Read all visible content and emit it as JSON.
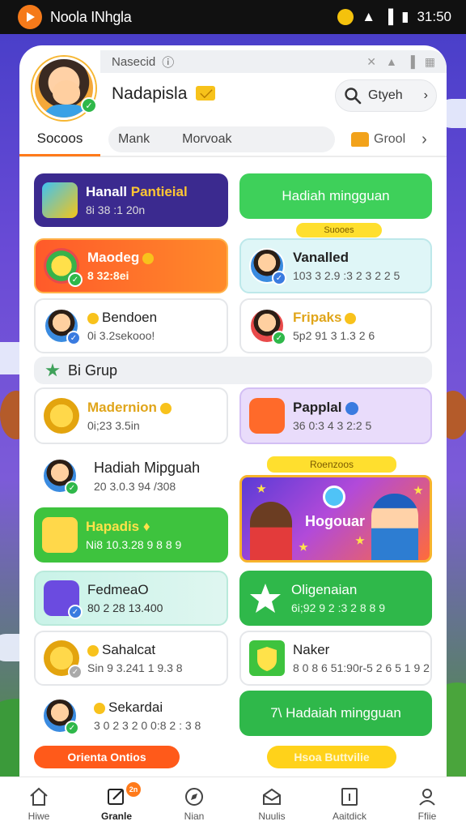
{
  "status_bar": {
    "app_name": "Noola INhgla",
    "time": "31:50"
  },
  "top_strip": {
    "label": "Nasecid"
  },
  "profile": {
    "name": "Nadapisla"
  },
  "search": {
    "label": "Gtyeh"
  },
  "tabs": {
    "active": "Socoos",
    "group_items": [
      "Mank",
      "Morvoak"
    ],
    "right_label": "Grool"
  },
  "tiles": {
    "hanall": {
      "title_a": "Hanall",
      "title_b": "Pantieial",
      "sub": "8i 38 :1 20n"
    },
    "hadiah_top": {
      "title": "Hadiah mingguan"
    },
    "maodeg": {
      "title": "Maodeg",
      "sub": "8 32:8ei"
    },
    "vanalled": {
      "title": "Vanalled",
      "sub": "103 3 2.9 :3 2 3 2 2 5"
    },
    "bendoen": {
      "title": "Bendoen",
      "sub": "0i 3.2sekooo!"
    },
    "fripaks": {
      "title": "Fripaks",
      "sub": "5p2 91 3 1.3 2 6"
    },
    "madernion": {
      "title": "Madernion",
      "sub": "0i;23 3.5in"
    },
    "papplal": {
      "title": "Papplal",
      "sub": "36 0:3 4 3 2:2 5"
    },
    "hadiah_minguah": {
      "title": "Hadiah Mipguah",
      "sub": "20 3.0.3 94 /308"
    },
    "hapadis": {
      "title": "Hapadis",
      "sub": "Ni8 10.3.28 9 8 8 9"
    },
    "fedmeao": {
      "title": "FedmeaO",
      "sub": "80 2 28 13.400"
    },
    "oligenaian": {
      "title": "Oligenaian",
      "sub": "6i;92 9 2 :3 2 8 8 9"
    },
    "sahalcat": {
      "title": "Sahalcat",
      "sub": "Sin 9 3.241 1 9.3 8"
    },
    "naker": {
      "title": "Naker",
      "sub": "8 0 8 6 51:90r-5 2 6 5 1 9 2 5"
    },
    "sekardai": {
      "title": "Sekardai",
      "sub": "3 0 2 3 2 0 0:8 2 : 3 8"
    },
    "hadaiah_bottom": {
      "title": "7\\ Hadaiah mingguan"
    }
  },
  "labels": {
    "chip_small": "Suooes",
    "banner_chip": "Roenzoos"
  },
  "section": {
    "title": "Bi Grup"
  },
  "banner": {
    "title": "Hogouar"
  },
  "buttons": {
    "orange": "Orienta Ontios",
    "yellow": "Hsoa Buttvilie"
  },
  "nav": [
    {
      "label": "Hiwe",
      "icon": "home-icon"
    },
    {
      "label": "Granle",
      "icon": "edit-icon",
      "badge": "2n"
    },
    {
      "label": "Nian",
      "icon": "compass-icon"
    },
    {
      "label": "Nuulis",
      "icon": "mail-open-icon"
    },
    {
      "label": "Aaitdick",
      "icon": "info-icon"
    },
    {
      "label": "Ffiie",
      "icon": "person-icon"
    }
  ]
}
